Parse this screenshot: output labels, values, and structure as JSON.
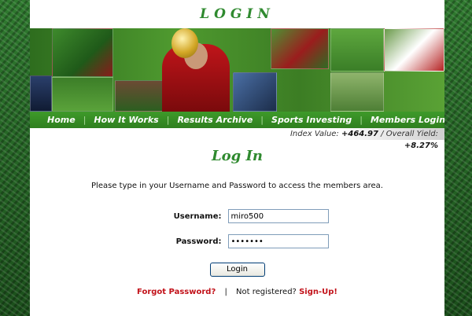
{
  "header": {
    "title": "LOGIN"
  },
  "nav": {
    "items": [
      {
        "label": "Home"
      },
      {
        "label": "How It Works"
      },
      {
        "label": "Results Archive"
      },
      {
        "label": "Sports Investing"
      },
      {
        "label": "Members Login"
      }
    ]
  },
  "ticker": {
    "index_label": "Index Value:",
    "index_value": "+464.97",
    "divider": "/",
    "yield_label": "Overall Yield:",
    "yield_value": "+8.27%"
  },
  "main": {
    "heading": "Log In",
    "instructions": "Please type in your Username and Password to access the members area.",
    "username": {
      "label": "Username:",
      "value": "miro500"
    },
    "password": {
      "label": "Password:",
      "value": "abcdefg"
    },
    "login_button": "Login",
    "forgot_link": "Forgot Password?",
    "separator": "|",
    "not_registered": "Not registered?",
    "signup_link": "Sign-Up!"
  },
  "colors": {
    "brand_green": "#2f8a2f",
    "nav_green": "#3e9a2a",
    "link_red": "#c2121a"
  },
  "icons": {
    "banner_images": "football-photo-collage"
  }
}
